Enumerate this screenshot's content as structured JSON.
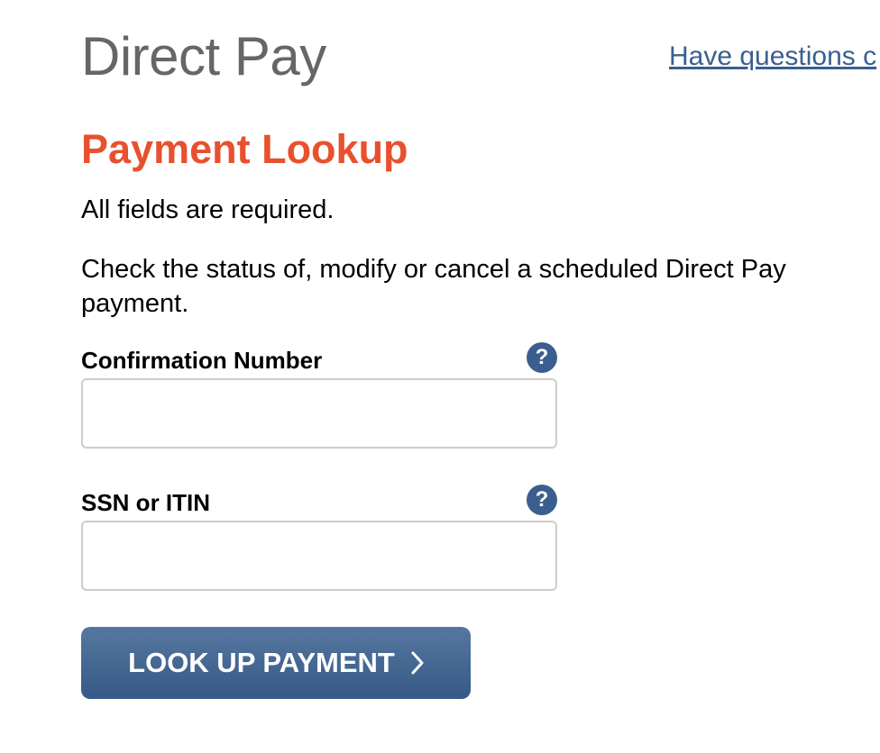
{
  "header": {
    "app_title": "Direct Pay",
    "help_link": "Have questions c"
  },
  "main": {
    "heading": "Payment Lookup",
    "required_note": "All fields are required.",
    "description": "Check the status of, modify or cancel a scheduled Direct Pay payment."
  },
  "form": {
    "confirmation": {
      "label": "Confirmation Number",
      "help_glyph": "?",
      "value": ""
    },
    "ssn": {
      "label": "SSN or ITIN",
      "help_glyph": "?",
      "value": ""
    },
    "submit_label": "LOOK UP PAYMENT",
    "submit_icon": "chevron-right-icon"
  },
  "colors": {
    "heading": "#e8502e",
    "link": "#3a5f8f",
    "button": "#436893",
    "title": "#666666"
  }
}
